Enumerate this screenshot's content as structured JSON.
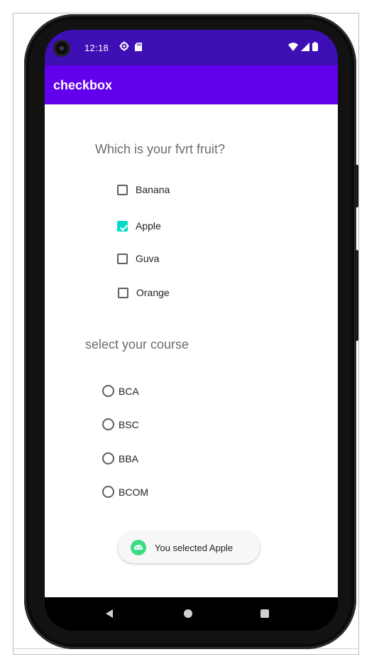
{
  "status_bar": {
    "time": "12:18",
    "icons_left": [
      "settings-icon",
      "sd-card-icon"
    ],
    "icons_right": [
      "wifi-icon",
      "signal-icon",
      "battery-icon"
    ]
  },
  "app_bar": {
    "title": "checkbox"
  },
  "fruit_section": {
    "question": "Which is your fvrt fruit?",
    "options": [
      {
        "label": "Banana",
        "checked": false
      },
      {
        "label": "Apple",
        "checked": true
      },
      {
        "label": "Guva",
        "checked": false
      },
      {
        "label": "Orange",
        "checked": false
      }
    ]
  },
  "course_section": {
    "question": "select your course",
    "options": [
      {
        "label": "BCA",
        "selected": false
      },
      {
        "label": "BSC",
        "selected": false
      },
      {
        "label": "BBA",
        "selected": false
      },
      {
        "label": "BCOM",
        "selected": false
      }
    ]
  },
  "toast": {
    "message": "You selected Apple",
    "icon": "android-icon"
  },
  "nav_bar": {
    "buttons": [
      "back-icon",
      "home-icon",
      "recents-icon"
    ]
  },
  "colors": {
    "status_bar": "#3d0fb4",
    "app_bar": "#6200ee",
    "checkbox_checked": "#03dac5",
    "android_green": "#3ddc84"
  }
}
